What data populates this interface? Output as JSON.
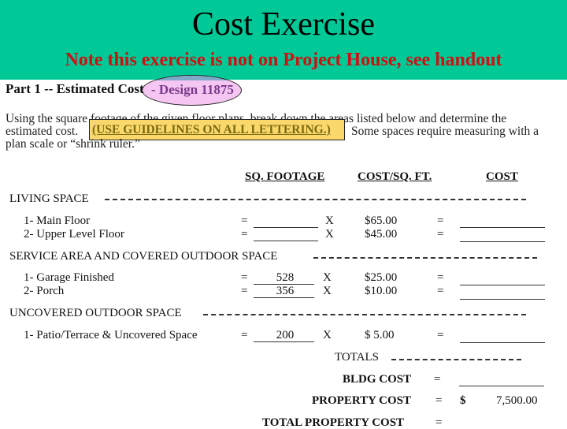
{
  "header": {
    "title": "Cost Exercise",
    "subtitle": "Note this exercise is not on Project House, see handout",
    "background_color": "#00c896",
    "subtitle_color": "#cc1111"
  },
  "part": {
    "label": "Part 1 -- Estimated Cost",
    "design_label": "- Design 11875"
  },
  "instructions": {
    "line1": "Using the square footage of the given floor plans, break down the areas listed below and determine the",
    "line2_prefix": "estimated cost.",
    "highlight": "(USE GUIDELINES ON ALL LETTERING.)",
    "line2_suffix": "Some spaces require measuring with a",
    "line3": "plan scale or “shrink ruler.”"
  },
  "columns": {
    "sq_footage": "SQ. FOOTAGE",
    "cost_per_sqft": "COST/SQ. FT.",
    "cost": "COST"
  },
  "sections": [
    {
      "title": "LIVING SPACE",
      "rows": [
        {
          "label": "1-  Main Floor",
          "sq_ft": "",
          "cost_per_sqft": "$65.00",
          "cost": ""
        },
        {
          "label": "2-  Upper Level Floor",
          "sq_ft": "",
          "cost_per_sqft": "$45.00",
          "cost": ""
        }
      ]
    },
    {
      "title": "SERVICE AREA AND COVERED OUTDOOR SPACE",
      "rows": [
        {
          "label": "1-  Garage Finished",
          "sq_ft": "528",
          "cost_per_sqft": "$25.00",
          "cost": ""
        },
        {
          "label": "2-  Porch",
          "sq_ft": "356",
          "cost_per_sqft": "$10.00",
          "cost": ""
        }
      ]
    },
    {
      "title": "UNCOVERED OUTDOOR SPACE",
      "rows": [
        {
          "label": "1-  Patio/Terrace & Uncovered Space",
          "sq_ft": "200",
          "cost_per_sqft": "$  5.00",
          "cost": ""
        }
      ]
    }
  ],
  "symbols": {
    "equals": "=",
    "times": "X",
    "dollar": "$"
  },
  "totals": {
    "title": "TOTALS",
    "bldg_cost_label": "BLDG COST",
    "bldg_cost_value": "",
    "property_cost_label": "PROPERTY COST",
    "property_cost_value": "7,500.00",
    "total_property_cost_label": "TOTAL PROPERTY COST",
    "total_property_cost_value": ""
  }
}
